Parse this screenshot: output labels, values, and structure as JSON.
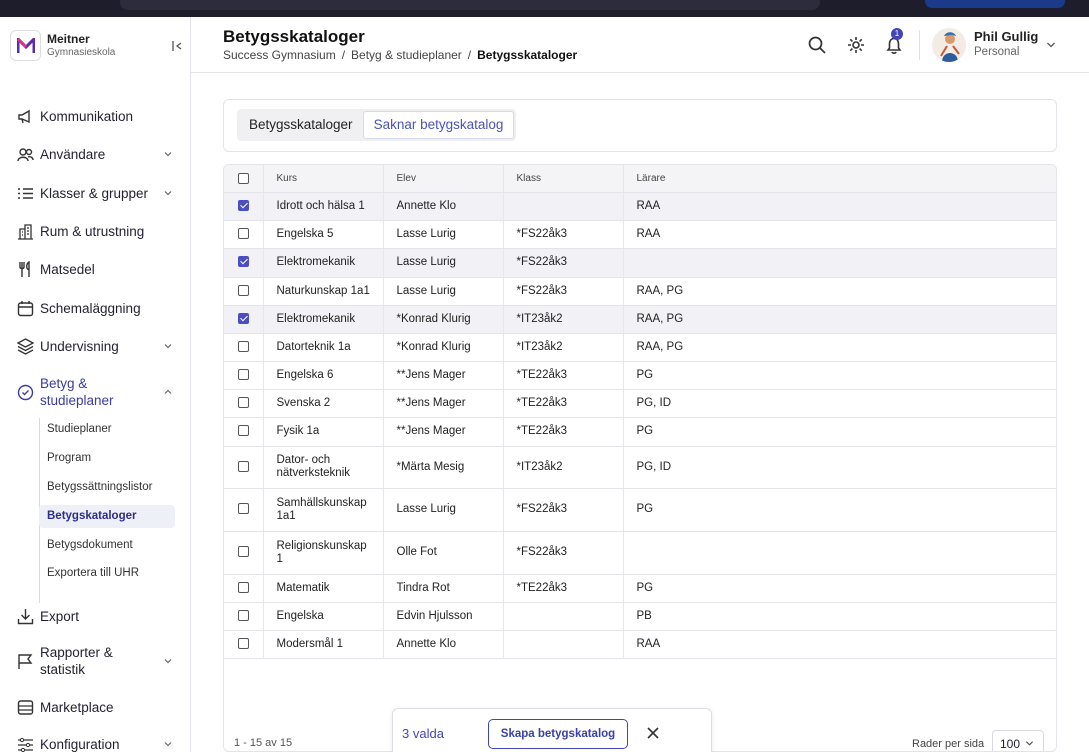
{
  "org": {
    "name": "Meitner",
    "subtitle": "Gymnasieskola"
  },
  "header": {
    "title": "Betygsskataloger",
    "breadcrumb": [
      "Success Gymnasium",
      "Betyg & studieplaner",
      "Betygsskataloger"
    ],
    "notifications_count": "1",
    "user": {
      "name": "Phil Gullig",
      "role": "Personal"
    }
  },
  "sidebar": {
    "items": [
      {
        "label": "Kommunikation",
        "icon": "megaphone-icon"
      },
      {
        "label": "Användare",
        "icon": "users-icon"
      },
      {
        "label": "Klasser & grupper",
        "icon": "list-icon"
      },
      {
        "label": "Rum & utrustning",
        "icon": "building-icon"
      },
      {
        "label": "Matsedel",
        "icon": "utensils-icon"
      },
      {
        "label": "Schemaläggning",
        "icon": "calendar-icon"
      },
      {
        "label": "Undervisning",
        "icon": "layers-icon"
      },
      {
        "label": "Betyg & studieplaner",
        "icon": "badge-check-icon"
      },
      {
        "label": "Export",
        "icon": "download-icon"
      },
      {
        "label": "Rapporter & statistik",
        "icon": "flag-icon"
      },
      {
        "label": "Marketplace",
        "icon": "store-icon"
      },
      {
        "label": "Konfiguration",
        "icon": "sliders-icon"
      }
    ],
    "subitems": [
      "Studieplaner",
      "Program",
      "Betygssättningslistor",
      "Betygskataloger",
      "Betygsdokument",
      "Exportera till UHR"
    ]
  },
  "tabs": [
    "Betygsskataloger",
    "Saknar betygskatalog"
  ],
  "table": {
    "columns": [
      "Kurs",
      "Elev",
      "Klass",
      "Lärare"
    ],
    "rows": [
      {
        "checked": true,
        "kurs": "Idrott och hälsa 1",
        "elev": "Annette Klo",
        "klass": "",
        "larare": "RAA"
      },
      {
        "checked": false,
        "kurs": "Engelska 5",
        "elev": "Lasse Lurig",
        "klass": "*FS22åk3",
        "larare": "RAA"
      },
      {
        "checked": true,
        "kurs": "Elektromekanik",
        "elev": "Lasse Lurig",
        "klass": "*FS22åk3",
        "larare": ""
      },
      {
        "checked": false,
        "kurs": "Naturkunskap 1a1",
        "elev": "Lasse Lurig",
        "klass": "*FS22åk3",
        "larare": "RAA, PG"
      },
      {
        "checked": true,
        "kurs": "Elektromekanik",
        "elev": "*Konrad Klurig",
        "klass": "*IT23åk2",
        "larare": "RAA, PG"
      },
      {
        "checked": false,
        "kurs": "Datorteknik 1a",
        "elev": "*Konrad Klurig",
        "klass": "*IT23åk2",
        "larare": "RAA, PG"
      },
      {
        "checked": false,
        "kurs": "Engelska 6",
        "elev": "**Jens Mager",
        "klass": "*TE22åk3",
        "larare": "PG"
      },
      {
        "checked": false,
        "kurs": "Svenska 2",
        "elev": "**Jens Mager",
        "klass": "*TE22åk3",
        "larare": "PG, ID"
      },
      {
        "checked": false,
        "kurs": "Fysik 1a",
        "elev": "**Jens Mager",
        "klass": "*TE22åk3",
        "larare": "PG"
      },
      {
        "checked": false,
        "kurs": "Dator- och nätverksteknik",
        "elev": "*Märta Mesig",
        "klass": "*IT23åk2",
        "larare": "PG, ID"
      },
      {
        "checked": false,
        "kurs": "Samhällskunskap 1a1",
        "elev": "Lasse Lurig",
        "klass": "*FS22åk3",
        "larare": "PG"
      },
      {
        "checked": false,
        "kurs": "Religionskunskap 1",
        "elev": "Olle Fot",
        "klass": "*FS22åk3",
        "larare": ""
      },
      {
        "checked": false,
        "kurs": "Matematik",
        "elev": "Tindra Rot",
        "klass": "*TE22åk3",
        "larare": "PG"
      },
      {
        "checked": false,
        "kurs": "Engelska",
        "elev": "Edvin Hjulsson",
        "klass": "",
        "larare": "PB"
      },
      {
        "checked": false,
        "kurs": "Modersmål 1",
        "elev": "Annette Klo",
        "klass": "",
        "larare": "RAA"
      }
    ]
  },
  "footer": {
    "range": "1 - 15 av 15",
    "rows_label": "Rader per sida",
    "rows_value": "100"
  },
  "selection": {
    "count_label": "3 valda",
    "create_label": "Skapa betygskatalog"
  },
  "colors": {
    "accent": "#4046b8"
  }
}
